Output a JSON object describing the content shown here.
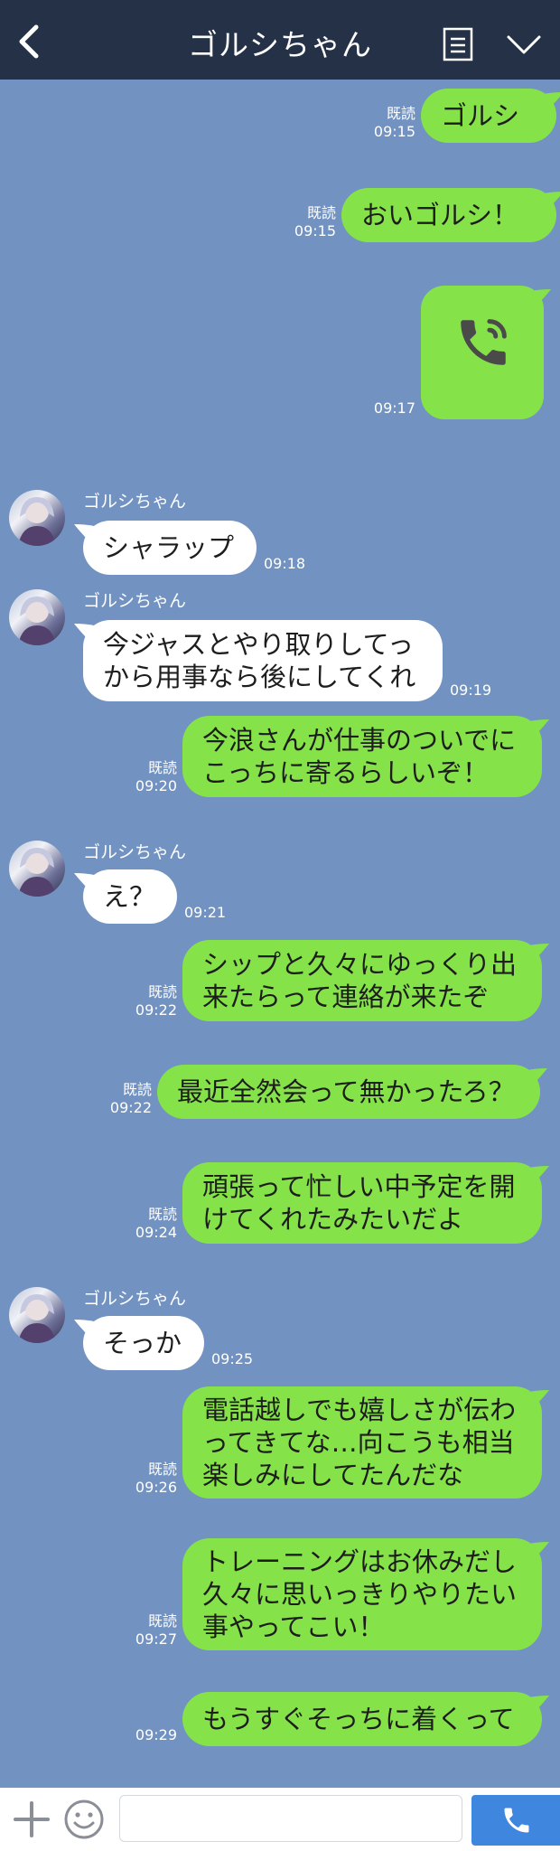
{
  "header": {
    "title": "ゴルシちゃん"
  },
  "colors": {
    "header_bg": "#243147",
    "chat_bg": "#7293c1",
    "my_bubble": "#85e249",
    "their_bubble": "#ffffff",
    "send_button": "#3f86de"
  },
  "messages": [
    {
      "from": "me",
      "text": [
        "ゴルシ"
      ],
      "read": "既読",
      "time": "09:15"
    },
    {
      "from": "me",
      "text": [
        "おいゴルシ！"
      ],
      "read": "既読",
      "time": "09:15"
    },
    {
      "from": "me",
      "type": "call",
      "icon": "phone-icon",
      "time": "09:17"
    },
    {
      "from": "them",
      "sender": "ゴルシちゃん",
      "text": [
        "シャラップ"
      ],
      "time": "09:18"
    },
    {
      "from": "them",
      "sender": "ゴルシちゃん",
      "text": [
        "今ジャスとやり取りしてっ",
        "から用事なら後にしてくれ"
      ],
      "time": "09:19"
    },
    {
      "from": "me",
      "text": [
        "今浪さんが仕事のついでに",
        "こっちに寄るらしいぞ！"
      ],
      "read": "既読",
      "time": "09:20"
    },
    {
      "from": "them",
      "sender": "ゴルシちゃん",
      "text": [
        "え？"
      ],
      "time": "09:21"
    },
    {
      "from": "me",
      "text": [
        "シップと久々にゆっくり出",
        "来たらって連絡が来たぞ"
      ],
      "read": "既読",
      "time": "09:22"
    },
    {
      "from": "me",
      "text": [
        "最近全然会って無かったろ？"
      ],
      "read": "既読",
      "time": "09:22"
    },
    {
      "from": "me",
      "text": [
        "頑張って忙しい中予定を開",
        "けてくれたみたいだよ"
      ],
      "read": "既読",
      "time": "09:24"
    },
    {
      "from": "them",
      "sender": "ゴルシちゃん",
      "text": [
        "そっか"
      ],
      "time": "09:25"
    },
    {
      "from": "me",
      "text": [
        "電話越しでも嬉しさが伝わ",
        "ってきてな…向こうも相当",
        "楽しみにしてたんだな"
      ],
      "read": "既読",
      "time": "09:26"
    },
    {
      "from": "me",
      "text": [
        "トレーニングはお休みだし",
        "久々に思いっきりやりたい",
        "事やってこい！"
      ],
      "read": "既読",
      "time": "09:27"
    },
    {
      "from": "me",
      "text": [
        "もうすぐそっちに着くって"
      ],
      "time": "09:29"
    }
  ],
  "footer": {
    "icons": [
      "plus-icon",
      "emoji-icon",
      "phone-icon"
    ]
  }
}
